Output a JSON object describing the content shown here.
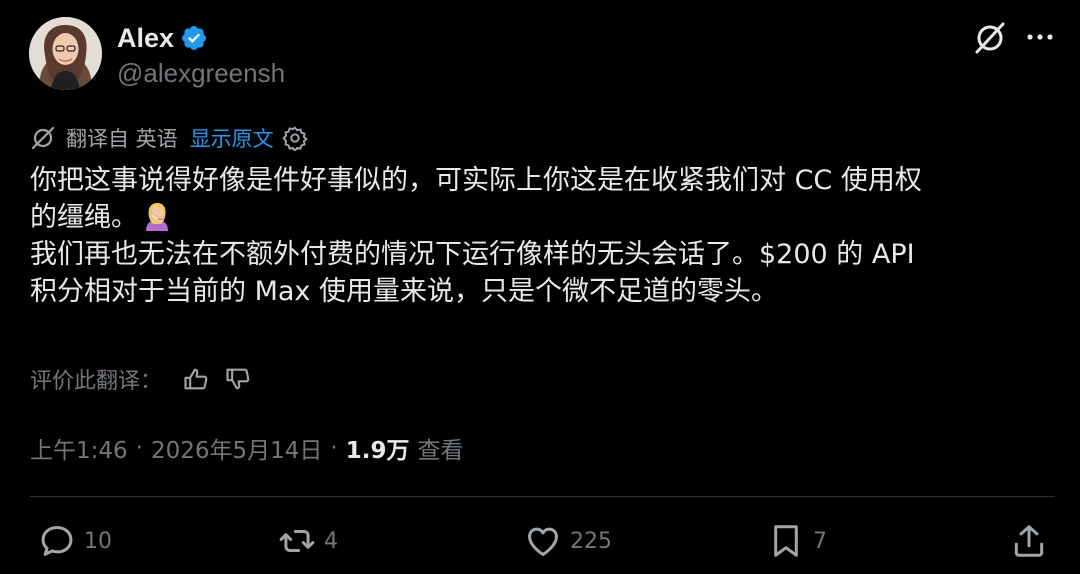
{
  "author": {
    "name": "Alex",
    "handle": "@alexgreensh",
    "verified_color": "#1d9bf0"
  },
  "header_icons": [
    "grok-icon",
    "more-icon"
  ],
  "translation": {
    "label": "翻译自 英语",
    "show_original": "显示原文",
    "icon": "translate-icon",
    "settings_icon": "gear-icon"
  },
  "tweet": {
    "lines": [
      "你把这事说得好像是件好事似的，可实际上你这是在收紧我们对 CC 使用权",
      "的缰绳。",
      "我们再也无法在不额外付费的情况下运行像样的无头会话了。$200 的 API",
      "积分相对于当前的 Max 使用量来说，只是个微不足道的零头。"
    ],
    "emoji": "person-facepalming-emoji"
  },
  "rate_translation": {
    "label": "评价此翻译："
  },
  "meta": {
    "time": "上午1:46",
    "date": "2026年5月14日",
    "separator": "·",
    "views_count": "1.9万",
    "views_label": "查看"
  },
  "actions": {
    "reply": "10",
    "retweet": "4",
    "like": "225",
    "bookmark": "7"
  },
  "colors": {
    "background": "#000000",
    "text": "#e7e9ea",
    "secondary": "#71767b",
    "accent": "#1d9bf0",
    "divider": "#2f3336"
  }
}
